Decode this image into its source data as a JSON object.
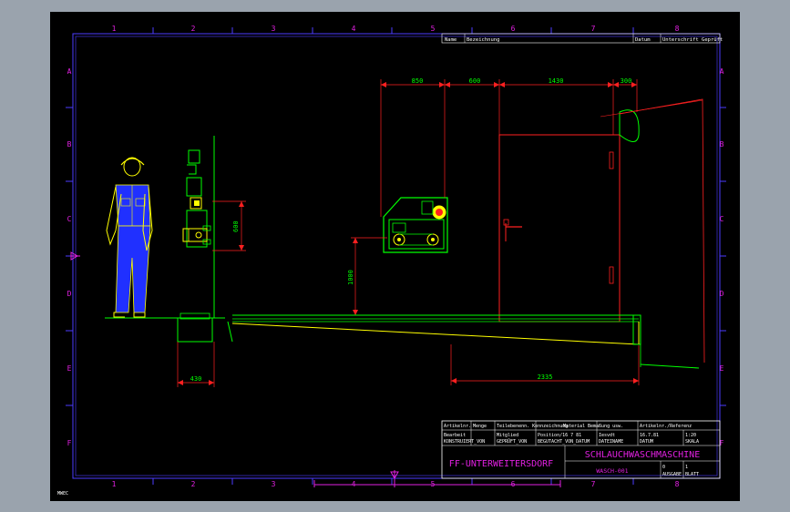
{
  "viewport": {
    "bg_color": "#9aa3ad",
    "canvas_color": "#000000",
    "logo_text": "MWEC"
  },
  "frame": {
    "column_labels": [
      "1",
      "2",
      "3",
      "4",
      "5",
      "6",
      "7",
      "8"
    ],
    "row_labels": [
      "A",
      "B",
      "C",
      "D",
      "E",
      "F"
    ],
    "frame_color": "#4b3cff",
    "label_color": "#e020e0"
  },
  "header": {
    "name_label": "Name",
    "name_value": "Bezeichnung",
    "date_label": "Datum",
    "check_label": "Unterschrift Geprüft"
  },
  "dimensions": {
    "top": [
      "850",
      "600",
      "1430",
      "300"
    ],
    "height_600": "600",
    "height_1000": "1000",
    "width_430": "430",
    "width_2335": "2335"
  },
  "title_block": {
    "row1": [
      "Artikelnr.",
      "Menge",
      "Teilebenenn. Kennzeichnung",
      "Material",
      "Bemaßung usw.",
      "Artikelnr./Referenz"
    ],
    "row2": [
      "Bearbeit",
      "Mitglied",
      "Position/16 7 81",
      "Iesvdt",
      "16.7.81",
      "1:20"
    ],
    "row3": [
      "KONSTRUIERT_VON",
      "GEPRÜFT_VON",
      "BEGUTACHT_VON_DATUM",
      "DATEINAME",
      "DATUM",
      "SKALA"
    ],
    "title": "SCHLAUCHWASCHMASCHINE",
    "company": "FF-UNTERWEITERSDORF",
    "drawing_no": "WASCH-001",
    "sheet_small_1": "0",
    "sheet_small_2": "1",
    "edition_label": "AUSGABE",
    "sheet_label": "BLATT"
  }
}
